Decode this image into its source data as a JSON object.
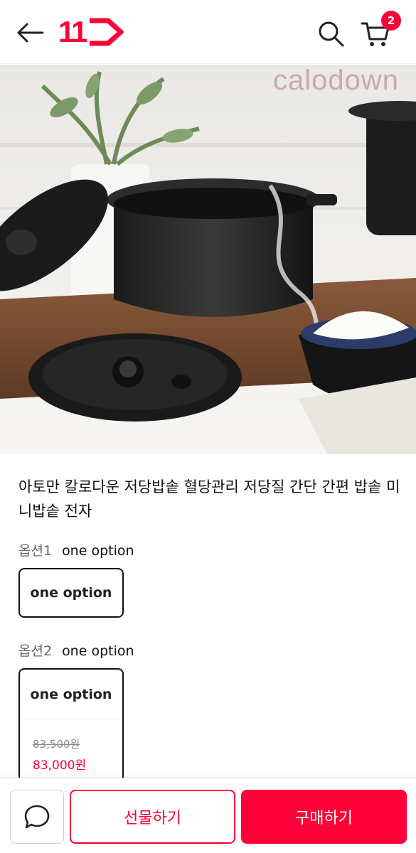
{
  "header": {
    "logo_text": "11",
    "cart_count": "2",
    "back_icon": "back-arrow-icon",
    "search_icon": "search-icon",
    "cart_icon": "cart-icon"
  },
  "hero": {
    "brand_mark": "calodown"
  },
  "product": {
    "title": "아토만 칼로다운 저당밥솥 혈당관리 저당질 간단 간편 밥솥 미니밥솥 전자"
  },
  "options": [
    {
      "label": "옵션1",
      "selected": "one option",
      "chip_name": "one option"
    },
    {
      "label": "옵션2",
      "selected": "one option",
      "chip_name": "one option",
      "original_price": "83,500원",
      "sale_price": "83,000원"
    }
  ],
  "bottom_bar": {
    "chat_icon": "chat-bubble-icon",
    "gift_label": "선물하기",
    "buy_label": "구매하기"
  },
  "colors": {
    "brand": "#ff0038",
    "text": "#111111",
    "muted": "#666666"
  }
}
